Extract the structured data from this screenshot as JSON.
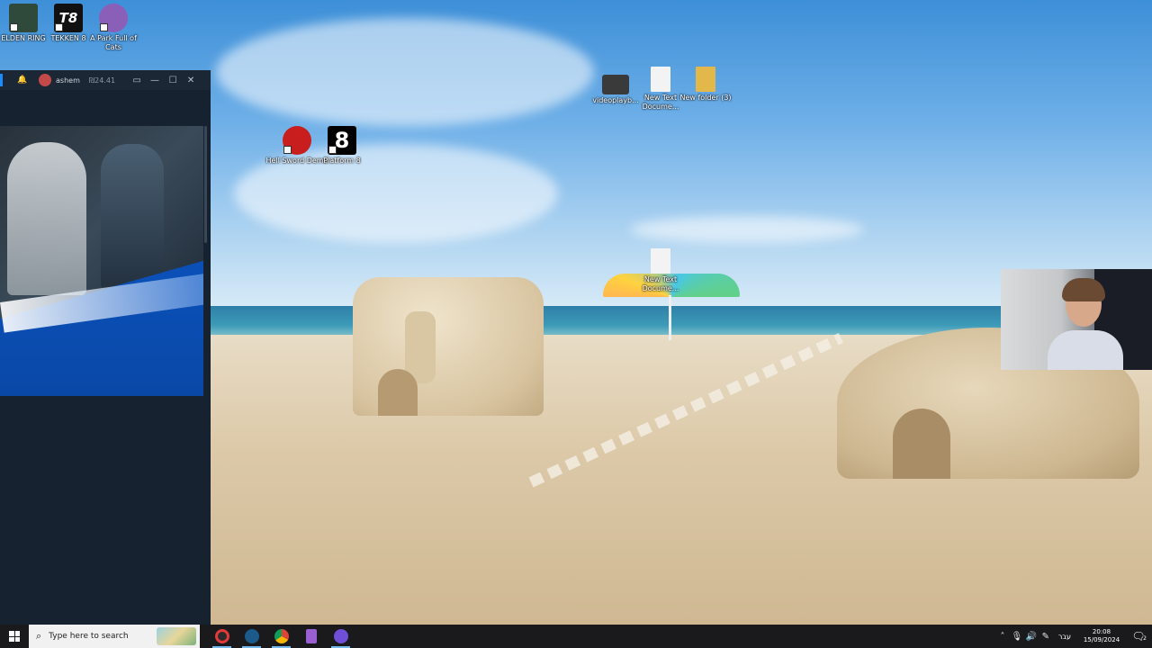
{
  "desktop": {
    "icons": [
      {
        "id": "elden-ring",
        "label": "ELDEN RING",
        "color": "#2f4a3a"
      },
      {
        "id": "tekken-8",
        "label": "TEKKEN 8",
        "color": "#111111",
        "glyph": "T8"
      },
      {
        "id": "a-park-full-of-cats",
        "label": "A Park Full of Cats",
        "color": "#8a5fb8"
      },
      {
        "id": "hell-sword-demo",
        "label": "Hell Sword Demo",
        "color": "#c81e1e"
      },
      {
        "id": "platform-8",
        "label": "Platform 8",
        "color": "#000000",
        "glyph": "8"
      },
      {
        "id": "videoplayback",
        "label": "videoplayb...",
        "color": "#3a3a3a"
      },
      {
        "id": "new-text-document-1",
        "label": "New Text Docume...",
        "color": "#f3f3f3"
      },
      {
        "id": "new-folder-3",
        "label": "New folder (3)",
        "color": "#e2b84a"
      },
      {
        "id": "new-text-document-2",
        "label": "New Text Docume...",
        "color": "#f3f3f3"
      }
    ]
  },
  "launcher": {
    "username": "ashem",
    "balance": "₪24.41",
    "controls": {
      "minimize": "—",
      "maximize": "☐",
      "close": "✕"
    },
    "accent_color": "#1a8cff"
  },
  "taskbar": {
    "search_placeholder": "Type here to search",
    "apps": [
      {
        "name": "obs-icon",
        "color": "#e03a3a"
      },
      {
        "name": "steam-icon",
        "color": "#1b5a8a"
      },
      {
        "name": "chrome-icon",
        "color": "#e8b63a"
      },
      {
        "name": "archive-icon",
        "color": "#9a5fd0"
      },
      {
        "name": "discord-icon",
        "color": "#6f4fd8"
      }
    ],
    "tray": {
      "language": "עבר",
      "time": "20:08",
      "date": "15/09/2024",
      "notification_count": "2"
    }
  }
}
